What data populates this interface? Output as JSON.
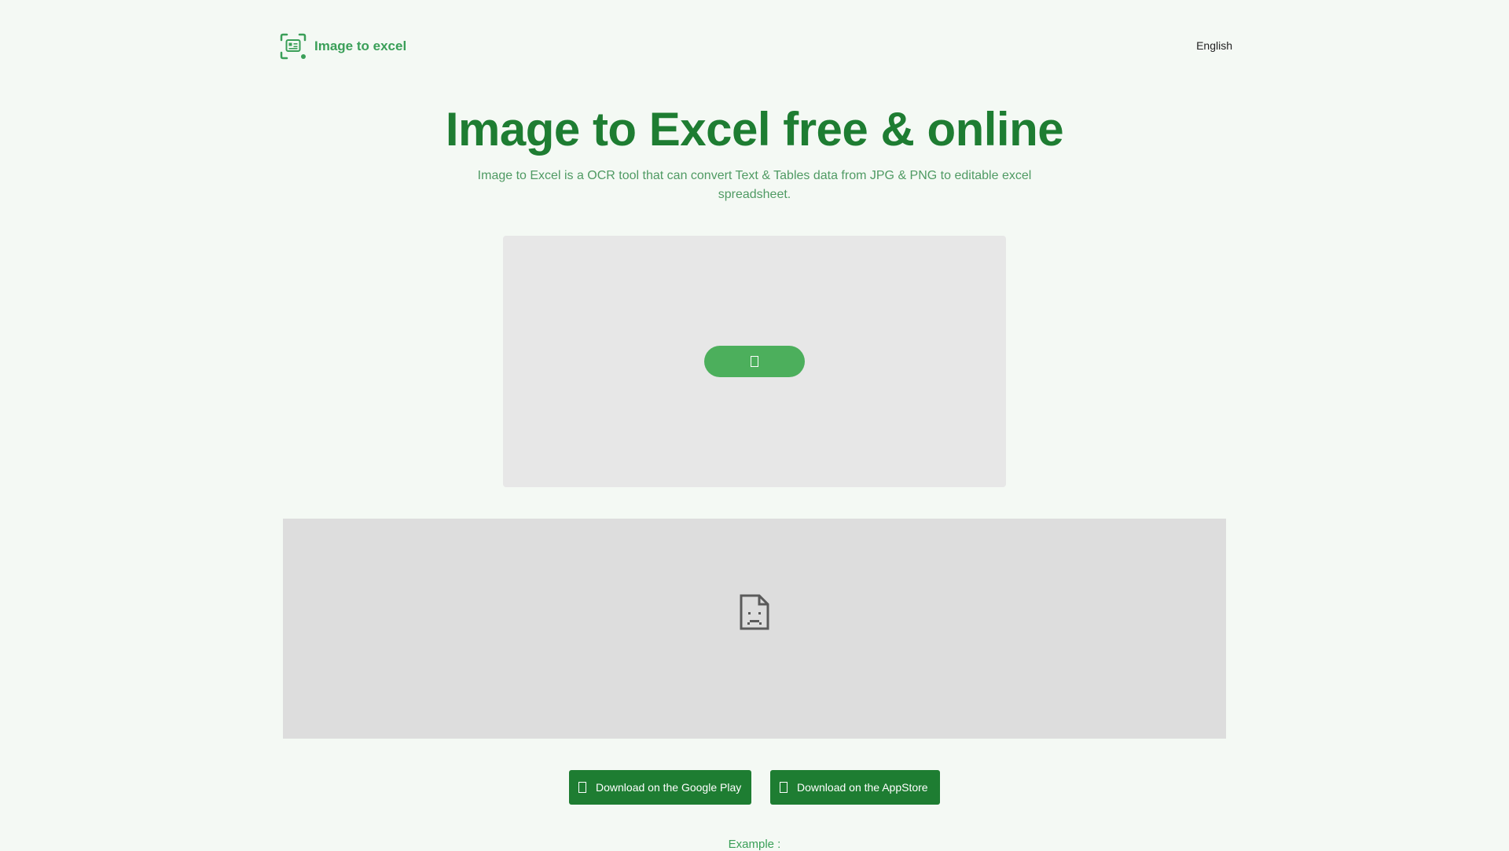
{
  "header": {
    "brand_name": "Image to excel",
    "brand_icon": "scan-document-icon",
    "language": "English"
  },
  "hero": {
    "title": "Image to Excel free & online",
    "subtitle": "Image to Excel is a OCR tool that can convert Text & Tables data from JPG & PNG to editable excel spreadsheet."
  },
  "upload": {
    "button_icon": "missing-glyph-icon"
  },
  "embed": {
    "icon": "broken-page-icon"
  },
  "downloads": {
    "google_play_label": "Download on the Google Play",
    "appstore_label": "Download on the AppStore"
  },
  "example": {
    "label": "Example :"
  },
  "colors": {
    "background": "#f4f9f4",
    "brand_green": "#3a9f58",
    "title_green": "#1e7d32",
    "upload_button_green": "#4caf5c",
    "download_button_green": "#1e7d32"
  }
}
